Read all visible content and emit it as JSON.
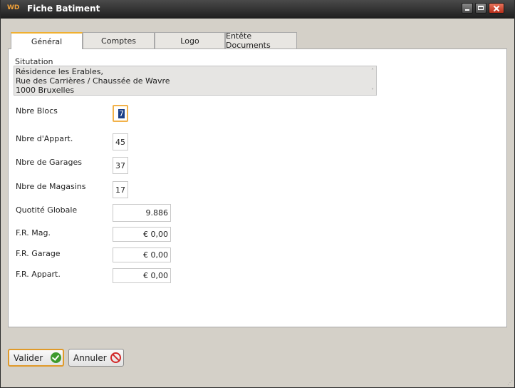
{
  "window": {
    "title": "Fiche Batiment",
    "app_icon": "WD"
  },
  "tabs": [
    {
      "label": "Général",
      "active": true
    },
    {
      "label": "Comptes",
      "active": false
    },
    {
      "label": "Logo",
      "active": false
    },
    {
      "label": "Entête Documents",
      "active": false
    }
  ],
  "situation": {
    "label": "Situtation",
    "text": "Résidence les Erables,\nRue des Carrières / Chaussée de Wavre\n1000 Bruxelles",
    "scroll_up": "˄",
    "scroll_down": "˅"
  },
  "fields": {
    "blocs": {
      "label": "Nbre Blocs",
      "value": "7"
    },
    "appart": {
      "label": "Nbre d'Appart.",
      "value": "45"
    },
    "garages": {
      "label": "Nbre de Garages",
      "value": "37"
    },
    "magasins": {
      "label": "Nbre de Magasins",
      "value": "17"
    },
    "quotite": {
      "label": "Quotité Globale",
      "value": "9.886"
    },
    "fr_mag": {
      "label": "F.R. Mag.",
      "value": "€ 0,00"
    },
    "fr_garage": {
      "label": "F.R. Garage",
      "value": "€ 0,00"
    },
    "fr_appart": {
      "label": "F.R. Appart.",
      "value": "€ 0,00"
    }
  },
  "buttons": {
    "valider": "Valider",
    "annuler": "Annuler"
  },
  "icons": {
    "window_minimize": "minimize-icon",
    "window_maximize": "maximize-icon",
    "window_close": "close-icon",
    "valider": "check-icon",
    "annuler": "cancel-icon"
  },
  "colors": {
    "tab_accent": "#f0b030",
    "focus_border": "#f2b24a",
    "ok_green": "#3d9a2c",
    "cancel_red": "#d12828"
  }
}
